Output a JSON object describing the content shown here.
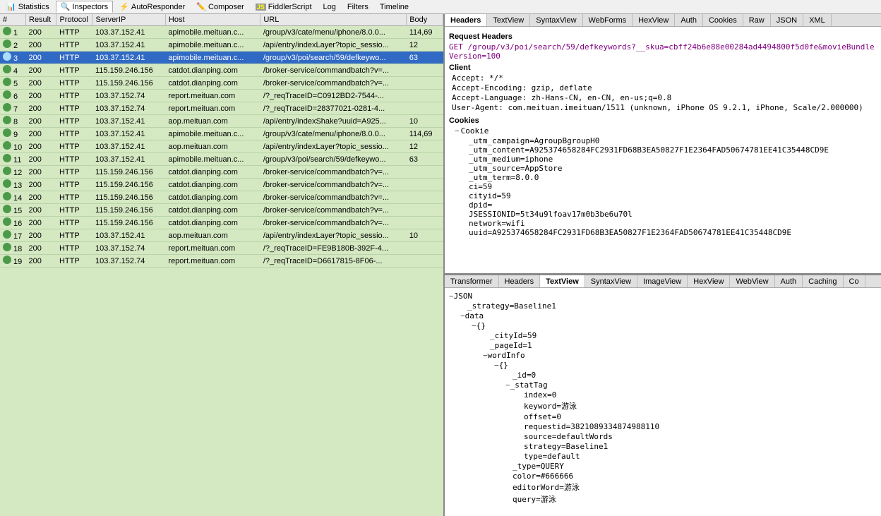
{
  "toolbar": {
    "tabs": [
      {
        "label": "Statistics",
        "icon": "📊",
        "active": false
      },
      {
        "label": "Inspectors",
        "icon": "🔍",
        "active": true
      },
      {
        "label": "AutoResponder",
        "icon": "⚡",
        "active": false
      },
      {
        "label": "Composer",
        "icon": "✏️",
        "active": false
      },
      {
        "label": "FiddlerScript",
        "icon": "JS",
        "active": false
      },
      {
        "label": "Log",
        "icon": "",
        "active": false
      },
      {
        "label": "Filters",
        "icon": "",
        "active": false
      },
      {
        "label": "Timeline",
        "icon": "",
        "active": false
      }
    ]
  },
  "table": {
    "columns": [
      "#",
      "Result",
      "Protocol",
      "ServerIP",
      "Host",
      "URL",
      "Body"
    ],
    "rows": [
      {
        "num": "1",
        "result": "200",
        "protocol": "HTTP",
        "serverip": "103.37.152.41",
        "host": "apimobile.meituan.c...",
        "url": "/group/v3/cate/menu/iphone/8.0.0...",
        "body": "114,69",
        "selected": false
      },
      {
        "num": "2",
        "result": "200",
        "protocol": "HTTP",
        "serverip": "103.37.152.41",
        "host": "apimobile.meituan.c...",
        "url": "/api/entry/indexLayer?topic_sessio...",
        "body": "12",
        "selected": false
      },
      {
        "num": "3",
        "result": "200",
        "protocol": "HTTP",
        "serverip": "103.37.152.41",
        "host": "apimobile.meituan.c...",
        "url": "/group/v3/poi/search/59/defkeywo...",
        "body": "63",
        "selected": true
      },
      {
        "num": "4",
        "result": "200",
        "protocol": "HTTP",
        "serverip": "115.159.246.156",
        "host": "catdot.dianping.com",
        "url": "/broker-service/commandbatch?v=...",
        "body": "",
        "selected": false
      },
      {
        "num": "5",
        "result": "200",
        "protocol": "HTTP",
        "serverip": "115.159.246.156",
        "host": "catdot.dianping.com",
        "url": "/broker-service/commandbatch?v=...",
        "body": "",
        "selected": false
      },
      {
        "num": "6",
        "result": "200",
        "protocol": "HTTP",
        "serverip": "103.37.152.74",
        "host": "report.meituan.com",
        "url": "/?_reqTraceID=C0912BD2-7544-...",
        "body": "",
        "selected": false
      },
      {
        "num": "7",
        "result": "200",
        "protocol": "HTTP",
        "serverip": "103.37.152.74",
        "host": "report.meituan.com",
        "url": "/?_reqTraceID=28377021-0281-4...",
        "body": "",
        "selected": false
      },
      {
        "num": "8",
        "result": "200",
        "protocol": "HTTP",
        "serverip": "103.37.152.41",
        "host": "aop.meituan.com",
        "url": "/api/entry/indexShake?uuid=A925...",
        "body": "10",
        "selected": false
      },
      {
        "num": "9",
        "result": "200",
        "protocol": "HTTP",
        "serverip": "103.37.152.41",
        "host": "apimobile.meituan.c...",
        "url": "/group/v3/cate/menu/iphone/8.0.0...",
        "body": "114,69",
        "selected": false
      },
      {
        "num": "10",
        "result": "200",
        "protocol": "HTTP",
        "serverip": "103.37.152.41",
        "host": "aop.meituan.com",
        "url": "/api/entry/indexLayer?topic_sessio...",
        "body": "12",
        "selected": false
      },
      {
        "num": "11",
        "result": "200",
        "protocol": "HTTP",
        "serverip": "103.37.152.41",
        "host": "apimobile.meituan.c...",
        "url": "/group/v3/poi/search/59/defkeywo...",
        "body": "63",
        "selected": false
      },
      {
        "num": "12",
        "result": "200",
        "protocol": "HTTP",
        "serverip": "115.159.246.156",
        "host": "catdot.dianping.com",
        "url": "/broker-service/commandbatch?v=...",
        "body": "",
        "selected": false
      },
      {
        "num": "13",
        "result": "200",
        "protocol": "HTTP",
        "serverip": "115.159.246.156",
        "host": "catdot.dianping.com",
        "url": "/broker-service/commandbatch?v=...",
        "body": "",
        "selected": false
      },
      {
        "num": "14",
        "result": "200",
        "protocol": "HTTP",
        "serverip": "115.159.246.156",
        "host": "catdot.dianping.com",
        "url": "/broker-service/commandbatch?v=...",
        "body": "",
        "selected": false
      },
      {
        "num": "15",
        "result": "200",
        "protocol": "HTTP",
        "serverip": "115.159.246.156",
        "host": "catdot.dianping.com",
        "url": "/broker-service/commandbatch?v=...",
        "body": "",
        "selected": false
      },
      {
        "num": "16",
        "result": "200",
        "protocol": "HTTP",
        "serverip": "115.159.246.156",
        "host": "catdot.dianping.com",
        "url": "/broker-service/commandbatch?v=...",
        "body": "",
        "selected": false
      },
      {
        "num": "17",
        "result": "200",
        "protocol": "HTTP",
        "serverip": "103.37.152.41",
        "host": "aop.meituan.com",
        "url": "/api/entry/indexLayer?topic_sessio...",
        "body": "10",
        "selected": false
      },
      {
        "num": "18",
        "result": "200",
        "protocol": "HTTP",
        "serverip": "103.37.152.74",
        "host": "report.meituan.com",
        "url": "/?_reqTraceID=FE9B180B-392F-4...",
        "body": "",
        "selected": false
      },
      {
        "num": "19",
        "result": "200",
        "protocol": "HTTP",
        "serverip": "103.37.152.74",
        "host": "report.meituan.com",
        "url": "/?_reqTraceID=D6617815-8F06-...",
        "body": "",
        "selected": false
      }
    ]
  },
  "right_top": {
    "tabs": [
      "Headers",
      "TextView",
      "SyntaxView",
      "WebForms",
      "HexView",
      "Auth",
      "Cookies",
      "Raw",
      "JSON",
      "XML"
    ],
    "active_tab": "Headers",
    "section_title": "Request Headers",
    "request_line": "GET /group/v3/poi/search/59/defkeywords?__skua=cbff24b6e88e00284ad4494800f5d0fe&movieBundleVersion=100",
    "client_section": "Client",
    "client_headers": [
      "Accept: */*",
      "Accept-Encoding: gzip, deflate",
      "Accept-Language: zh-Hans-CN, en-CN, en-us;q=0.8",
      "User-Agent: com.meituan.imeituan/1511 (unknown, iPhone OS 9.2.1, iPhone, Scale/2.000000)"
    ],
    "cookies_section": "Cookies",
    "cookie_items": [
      "_utm_campaign=AgroupBgroupH0",
      "_utm_content=A925374658284FC2931FD68B3EA50827F1E2364FAD50674781EE41C35448CD9E",
      "_utm_medium=iphone",
      "_utm_source=AppStore",
      "_utm_term=8.0.0",
      "ci=59",
      "cityid=59",
      "dpid=",
      "JSESSIONID=5t34u9lfoav17m0b3be6u70l",
      "network=wifi",
      "uuid=A925374658284FC2931FD68B3EA50827F1E2364FAD50674781EE41C35448CD9E"
    ]
  },
  "right_bottom": {
    "tabs": [
      "Transformer",
      "Headers",
      "TextView",
      "SyntaxView",
      "ImageView",
      "HexView",
      "WebView",
      "Auth",
      "Caching",
      "Co"
    ],
    "active_tab": "TextView",
    "json_tree": [
      {
        "indent": 0,
        "expand": "−",
        "key": "JSON",
        "val": ""
      },
      {
        "indent": 1,
        "expand": "",
        "key": "_strategy",
        "val": "=Baseline1"
      },
      {
        "indent": 1,
        "expand": "−",
        "key": "data",
        "val": ""
      },
      {
        "indent": 2,
        "expand": "−",
        "key": "{}",
        "val": ""
      },
      {
        "indent": 3,
        "expand": "",
        "key": "_cityId",
        "val": "=59"
      },
      {
        "indent": 3,
        "expand": "",
        "key": "_pageId",
        "val": "=1"
      },
      {
        "indent": 3,
        "expand": "−",
        "key": "wordInfo",
        "val": ""
      },
      {
        "indent": 4,
        "expand": "−",
        "key": "{}",
        "val": ""
      },
      {
        "indent": 5,
        "expand": "",
        "key": "_id",
        "val": "=0"
      },
      {
        "indent": 5,
        "expand": "−",
        "key": "_statTag",
        "val": ""
      },
      {
        "indent": 6,
        "expand": "",
        "key": "index",
        "val": "=0"
      },
      {
        "indent": 6,
        "expand": "",
        "key": "keyword",
        "val": "=游泳"
      },
      {
        "indent": 6,
        "expand": "",
        "key": "offset",
        "val": "=0"
      },
      {
        "indent": 6,
        "expand": "",
        "key": "requestid",
        "val": "=382108933487498811​0"
      },
      {
        "indent": 6,
        "expand": "",
        "key": "source",
        "val": "=defaultWords"
      },
      {
        "indent": 6,
        "expand": "",
        "key": "strategy",
        "val": "=Baseline1"
      },
      {
        "indent": 6,
        "expand": "",
        "key": "type",
        "val": "=default"
      },
      {
        "indent": 5,
        "expand": "",
        "key": "_type",
        "val": "=QUERY"
      },
      {
        "indent": 5,
        "expand": "",
        "key": "color",
        "val": "=#666666"
      },
      {
        "indent": 5,
        "expand": "",
        "key": "editorWord",
        "val": "=游泳"
      },
      {
        "indent": 5,
        "expand": "",
        "key": "query",
        "val": "=游泳"
      }
    ]
  }
}
